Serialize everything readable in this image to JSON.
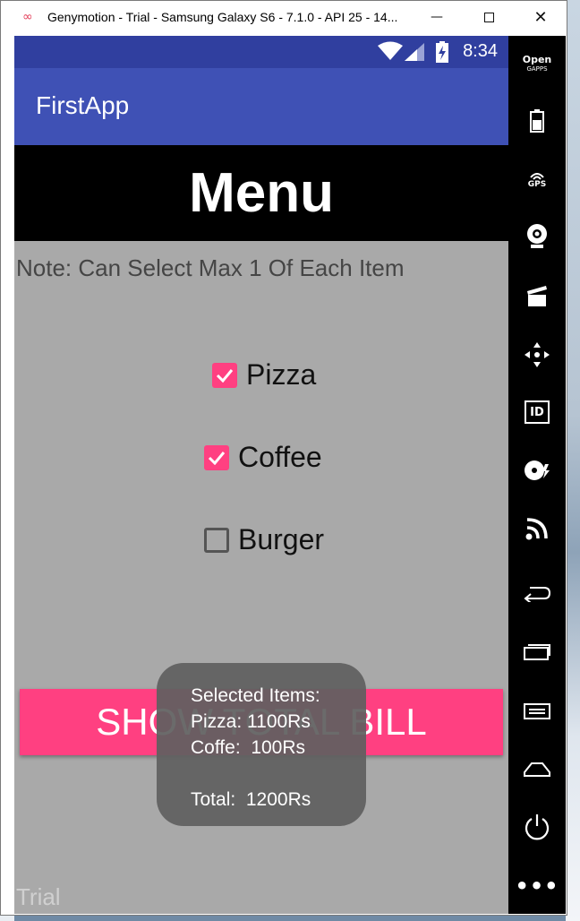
{
  "window": {
    "title": "Genymotion - Trial - Samsung Galaxy S6 - 7.1.0 - API 25 - 14...",
    "app_icon": "∞"
  },
  "status_bar": {
    "time": "8:34"
  },
  "app_bar": {
    "title": "FirstApp"
  },
  "header": {
    "title": "Menu"
  },
  "note": "Note: Can Select Max 1 Of Each Item",
  "items": [
    {
      "label": "Pizza",
      "checked": true
    },
    {
      "label": "Coffee",
      "checked": true
    },
    {
      "label": "Burger",
      "checked": false
    }
  ],
  "bill_button": {
    "label": "SHOW TOTAL BILL"
  },
  "toast": {
    "line1": "Selected Items:",
    "line2": "Pizza: 1100Rs",
    "line3": "Coffe:  100Rs",
    "line4": "Total:  1200Rs"
  },
  "watermark": "Trial",
  "toolbar": {
    "gapps_line1": "Open",
    "gapps_line2": "GAPPS",
    "gps": "GPS",
    "id": "ID"
  },
  "colors": {
    "primary_dark": "#303f9f",
    "primary": "#3f51b5",
    "accent": "#ff4081"
  }
}
